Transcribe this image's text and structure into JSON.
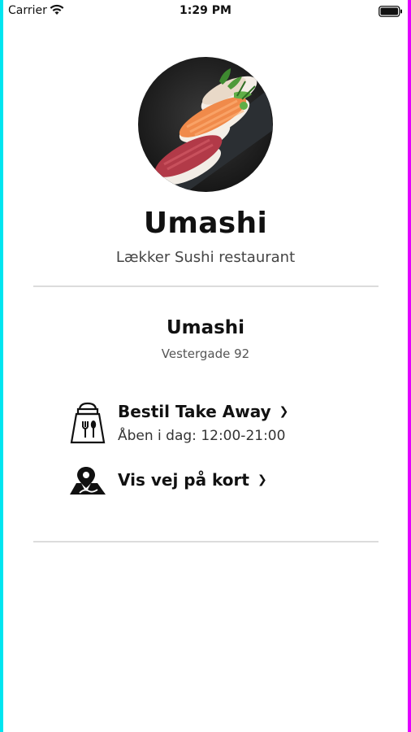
{
  "status_bar": {
    "carrier": "Carrier",
    "time": "1:29 PM"
  },
  "header": {
    "title": "Umashi",
    "subtitle": "Lækker Sushi restaurant"
  },
  "location": {
    "name": "Umashi",
    "address": "Vestergade 92"
  },
  "actions": [
    {
      "label": "Bestil Take Away",
      "sub": "Åben i dag: 12:00-21:00",
      "icon": "takeaway-bag-icon"
    },
    {
      "label": "Vis vej på kort",
      "icon": "map-pin-icon"
    }
  ],
  "colors": {
    "background": "#ffffff",
    "divider": "#dcdcdc",
    "text": "#111111",
    "left_edge": "#00e5f0",
    "right_edge": "#e000ff"
  }
}
